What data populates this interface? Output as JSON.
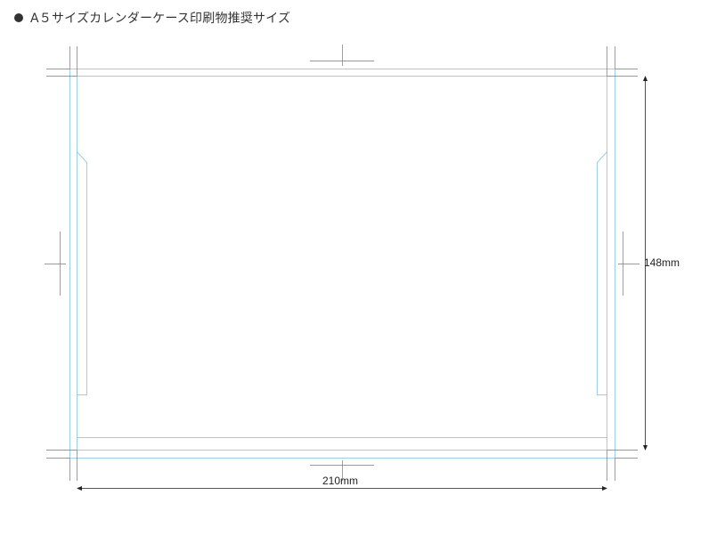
{
  "heading": {
    "text": "A５サイズカレンダーケース印刷物推奨サイズ",
    "bullet_icon": "bullet-circle-icon"
  },
  "dimensions": {
    "width_label": "210mm",
    "height_label": "148mm"
  },
  "colors": {
    "trim_line": "#9ecde6",
    "crop_mark": "#777777",
    "arrow": "#222222",
    "text": "#333333"
  }
}
